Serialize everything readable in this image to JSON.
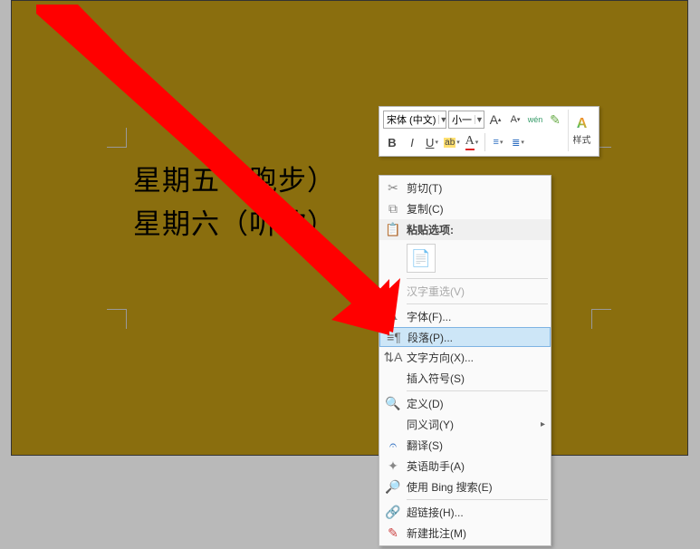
{
  "document": {
    "line1": "星期五（跑步）",
    "line2": "星期六（听歌）"
  },
  "toolbar": {
    "font_name": "宋体 (中文)",
    "font_size": "小一",
    "increase_font": "A",
    "decrease_font": "A",
    "pinyin": "wén",
    "bold": "B",
    "italic": "I",
    "underline": "U",
    "styles_label": "样式"
  },
  "context_menu": {
    "cut": "剪切(T)",
    "copy": "复制(C)",
    "paste_options_label": "粘贴选项:",
    "cjk_reselect": "汉字重选(V)",
    "font": "字体(F)...",
    "paragraph": "段落(P)...",
    "text_direction": "文字方向(X)...",
    "insert_symbol": "插入符号(S)",
    "define": "定义(D)",
    "synonyms": "同义词(Y)",
    "translate": "翻译(S)",
    "english_assistant": "英语助手(A)",
    "bing_search": "使用 Bing 搜索(E)",
    "hyperlink": "超链接(H)...",
    "new_comment": "新建批注(M)"
  }
}
